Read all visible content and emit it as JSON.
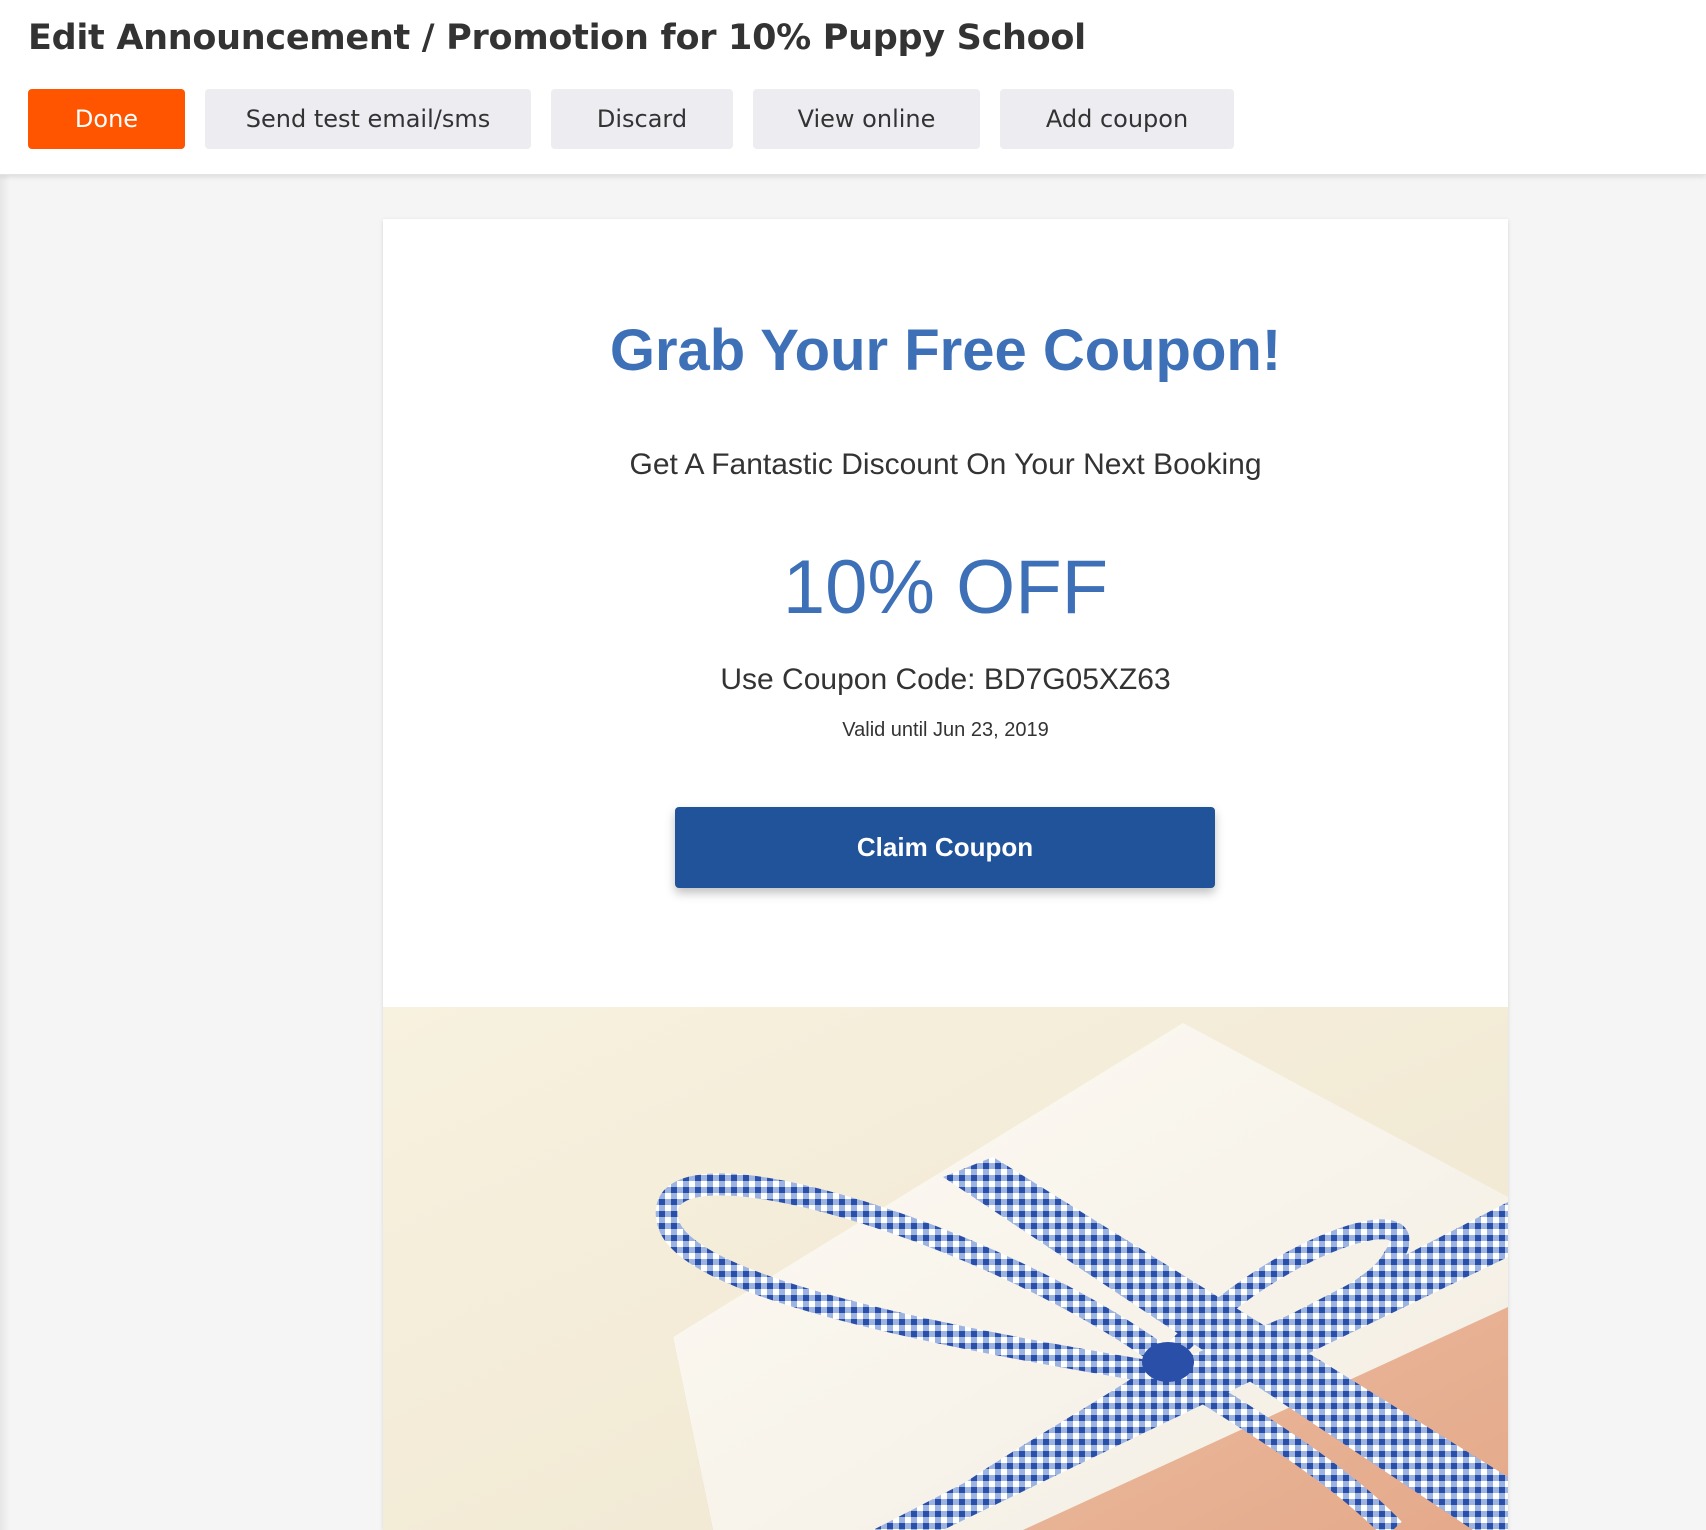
{
  "header": {
    "title": "Edit Announcement / Promotion for 10% Puppy School"
  },
  "toolbar": {
    "done_label": "Done",
    "send_test_label": "Send test email/sms",
    "discard_label": "Discard",
    "view_online_label": "View online",
    "add_coupon_label": "Add coupon"
  },
  "email": {
    "headline": "Grab Your Free Coupon!",
    "subheadline": "Get A Fantastic Discount On Your Next Booking",
    "discount": "10% OFF",
    "coupon_code_line": "Use Coupon Code: BD7G05XZ63",
    "valid_until": "Valid until Jun 23, 2019",
    "claim_button_label": "Claim Coupon",
    "image": "gift-box-with-blue-gingham-ribbon"
  },
  "colors": {
    "done_button": "#ff5500",
    "secondary_button": "#ececf1",
    "headline_blue": "#3d70b7",
    "claim_button": "#21539a"
  }
}
